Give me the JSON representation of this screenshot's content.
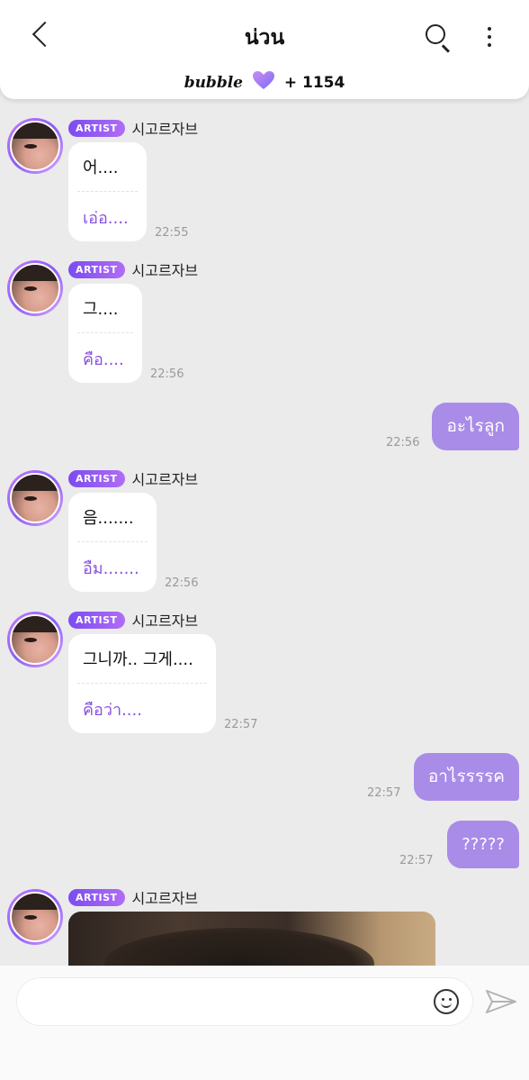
{
  "header": {
    "title": "น่วน",
    "bubble_logo": "bubble",
    "count": "+ 1154"
  },
  "messages": {
    "m1": {
      "badge": "ARTIST",
      "name": "시고르자브",
      "original": "어....",
      "translation": "เอ่อ....",
      "time": "22:55"
    },
    "m2": {
      "badge": "ARTIST",
      "name": "시고르자브",
      "original": "그....",
      "translation": "คือ....",
      "time": "22:56"
    },
    "r1": {
      "text": "อะไรลูก",
      "time": "22:56"
    },
    "m3": {
      "badge": "ARTIST",
      "name": "시고르자브",
      "original": "음.......",
      "translation": "อืม.......",
      "time": "22:56"
    },
    "m4": {
      "badge": "ARTIST",
      "name": "시고르자브",
      "original": "그니까.. 그게....",
      "translation": "คือว่า....",
      "time": "22:57"
    },
    "r2": {
      "text": "อาไรรรรค",
      "time": "22:57"
    },
    "r3": {
      "text": "?????",
      "time": "22:57"
    },
    "m5": {
      "badge": "ARTIST",
      "name": "시고르자브"
    }
  },
  "input": {
    "placeholder": ""
  },
  "colors": {
    "accent": "#a98be8",
    "translation": "#8a52e0",
    "badge": "#7b4cf0"
  },
  "icons": [
    "back-icon",
    "search-icon",
    "more-icon",
    "heart-icon",
    "emoji-icon",
    "send-icon"
  ]
}
